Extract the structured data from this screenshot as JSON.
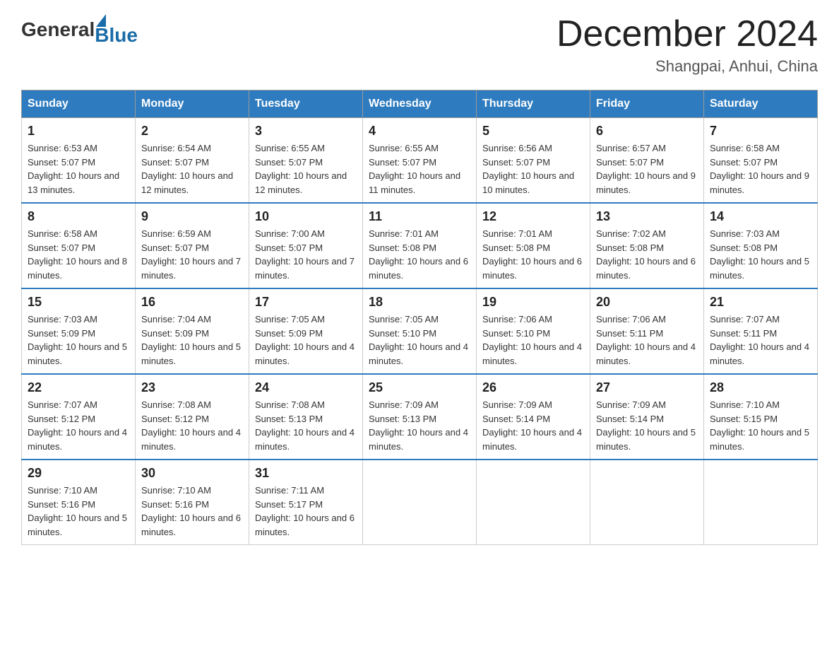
{
  "logo": {
    "general": "General",
    "blue": "Blue"
  },
  "header": {
    "month_title": "December 2024",
    "location": "Shangpai, Anhui, China"
  },
  "weekdays": [
    "Sunday",
    "Monday",
    "Tuesday",
    "Wednesday",
    "Thursday",
    "Friday",
    "Saturday"
  ],
  "weeks": [
    [
      {
        "day": "1",
        "sunrise": "6:53 AM",
        "sunset": "5:07 PM",
        "daylight": "10 hours and 13 minutes."
      },
      {
        "day": "2",
        "sunrise": "6:54 AM",
        "sunset": "5:07 PM",
        "daylight": "10 hours and 12 minutes."
      },
      {
        "day": "3",
        "sunrise": "6:55 AM",
        "sunset": "5:07 PM",
        "daylight": "10 hours and 12 minutes."
      },
      {
        "day": "4",
        "sunrise": "6:55 AM",
        "sunset": "5:07 PM",
        "daylight": "10 hours and 11 minutes."
      },
      {
        "day": "5",
        "sunrise": "6:56 AM",
        "sunset": "5:07 PM",
        "daylight": "10 hours and 10 minutes."
      },
      {
        "day": "6",
        "sunrise": "6:57 AM",
        "sunset": "5:07 PM",
        "daylight": "10 hours and 9 minutes."
      },
      {
        "day": "7",
        "sunrise": "6:58 AM",
        "sunset": "5:07 PM",
        "daylight": "10 hours and 9 minutes."
      }
    ],
    [
      {
        "day": "8",
        "sunrise": "6:58 AM",
        "sunset": "5:07 PM",
        "daylight": "10 hours and 8 minutes."
      },
      {
        "day": "9",
        "sunrise": "6:59 AM",
        "sunset": "5:07 PM",
        "daylight": "10 hours and 7 minutes."
      },
      {
        "day": "10",
        "sunrise": "7:00 AM",
        "sunset": "5:07 PM",
        "daylight": "10 hours and 7 minutes."
      },
      {
        "day": "11",
        "sunrise": "7:01 AM",
        "sunset": "5:08 PM",
        "daylight": "10 hours and 6 minutes."
      },
      {
        "day": "12",
        "sunrise": "7:01 AM",
        "sunset": "5:08 PM",
        "daylight": "10 hours and 6 minutes."
      },
      {
        "day": "13",
        "sunrise": "7:02 AM",
        "sunset": "5:08 PM",
        "daylight": "10 hours and 6 minutes."
      },
      {
        "day": "14",
        "sunrise": "7:03 AM",
        "sunset": "5:08 PM",
        "daylight": "10 hours and 5 minutes."
      }
    ],
    [
      {
        "day": "15",
        "sunrise": "7:03 AM",
        "sunset": "5:09 PM",
        "daylight": "10 hours and 5 minutes."
      },
      {
        "day": "16",
        "sunrise": "7:04 AM",
        "sunset": "5:09 PM",
        "daylight": "10 hours and 5 minutes."
      },
      {
        "day": "17",
        "sunrise": "7:05 AM",
        "sunset": "5:09 PM",
        "daylight": "10 hours and 4 minutes."
      },
      {
        "day": "18",
        "sunrise": "7:05 AM",
        "sunset": "5:10 PM",
        "daylight": "10 hours and 4 minutes."
      },
      {
        "day": "19",
        "sunrise": "7:06 AM",
        "sunset": "5:10 PM",
        "daylight": "10 hours and 4 minutes."
      },
      {
        "day": "20",
        "sunrise": "7:06 AM",
        "sunset": "5:11 PM",
        "daylight": "10 hours and 4 minutes."
      },
      {
        "day": "21",
        "sunrise": "7:07 AM",
        "sunset": "5:11 PM",
        "daylight": "10 hours and 4 minutes."
      }
    ],
    [
      {
        "day": "22",
        "sunrise": "7:07 AM",
        "sunset": "5:12 PM",
        "daylight": "10 hours and 4 minutes."
      },
      {
        "day": "23",
        "sunrise": "7:08 AM",
        "sunset": "5:12 PM",
        "daylight": "10 hours and 4 minutes."
      },
      {
        "day": "24",
        "sunrise": "7:08 AM",
        "sunset": "5:13 PM",
        "daylight": "10 hours and 4 minutes."
      },
      {
        "day": "25",
        "sunrise": "7:09 AM",
        "sunset": "5:13 PM",
        "daylight": "10 hours and 4 minutes."
      },
      {
        "day": "26",
        "sunrise": "7:09 AM",
        "sunset": "5:14 PM",
        "daylight": "10 hours and 4 minutes."
      },
      {
        "day": "27",
        "sunrise": "7:09 AM",
        "sunset": "5:14 PM",
        "daylight": "10 hours and 5 minutes."
      },
      {
        "day": "28",
        "sunrise": "7:10 AM",
        "sunset": "5:15 PM",
        "daylight": "10 hours and 5 minutes."
      }
    ],
    [
      {
        "day": "29",
        "sunrise": "7:10 AM",
        "sunset": "5:16 PM",
        "daylight": "10 hours and 5 minutes."
      },
      {
        "day": "30",
        "sunrise": "7:10 AM",
        "sunset": "5:16 PM",
        "daylight": "10 hours and 6 minutes."
      },
      {
        "day": "31",
        "sunrise": "7:11 AM",
        "sunset": "5:17 PM",
        "daylight": "10 hours and 6 minutes."
      },
      null,
      null,
      null,
      null
    ]
  ]
}
